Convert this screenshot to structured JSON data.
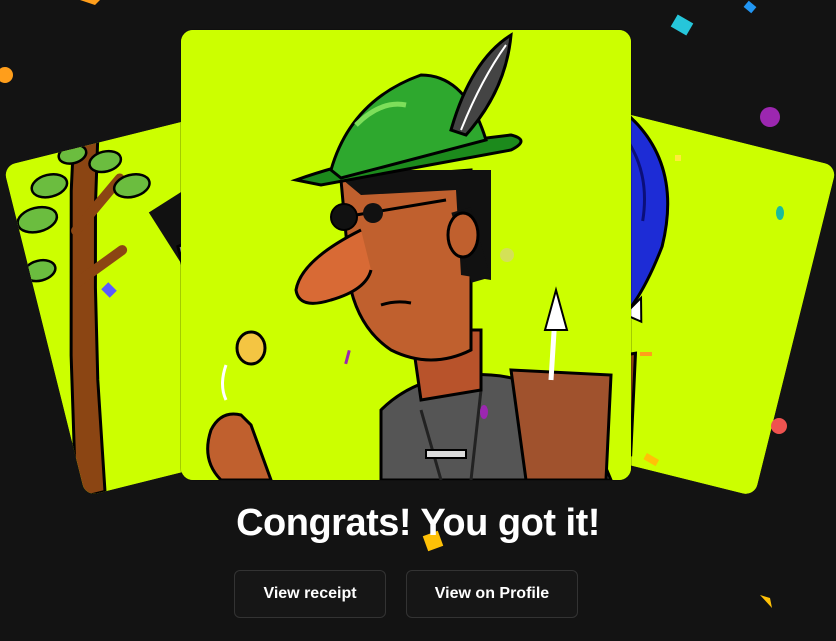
{
  "title": "Congrats! You got it!",
  "buttons": {
    "receipt_label": "View receipt",
    "profile_label": "View on Profile"
  },
  "cards": [
    {
      "id": "left",
      "description_icon": "nft-card-character-tree"
    },
    {
      "id": "center",
      "description_icon": "nft-card-robin-hood-character"
    },
    {
      "id": "right",
      "description_icon": "nft-card-character-blue-hair"
    }
  ],
  "colors": {
    "background": "#131313",
    "card_bg": "#ccff00",
    "text": "#ffffff",
    "button_bg": "#161616",
    "button_border": "#333333"
  }
}
